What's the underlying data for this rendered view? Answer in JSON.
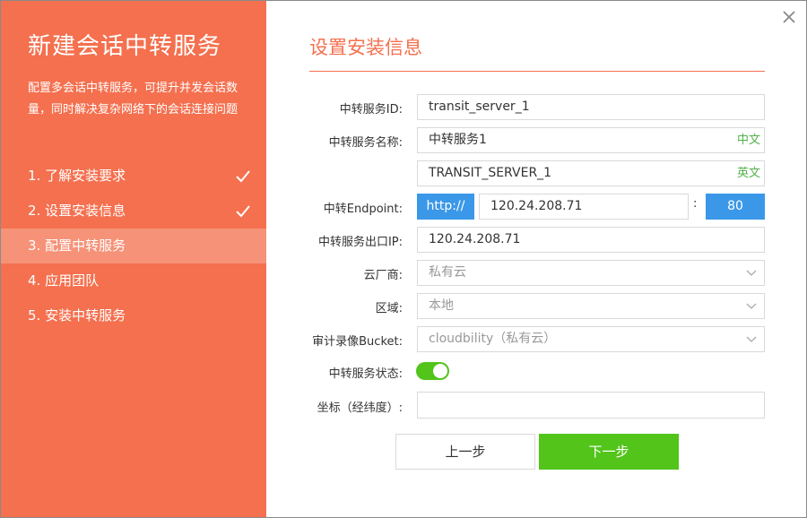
{
  "sidebar": {
    "title": "新建会话中转服务",
    "description": "配置多会话中转服务，可提升并发会话数量，同时解决复杂网络下的会话连接问题",
    "steps": [
      {
        "label": "1. 了解安装要求",
        "done": true
      },
      {
        "label": "2. 设置安装信息",
        "done": true
      },
      {
        "label": "3. 配置中转服务",
        "active": true
      },
      {
        "label": "4. 应用团队"
      },
      {
        "label": "5. 安装中转服务"
      }
    ]
  },
  "main": {
    "title": "设置安装信息",
    "fields": {
      "server_id": {
        "label": "中转服务ID:",
        "value": "transit_server_1"
      },
      "server_name": {
        "label": "中转服务名称:",
        "value_cn": "中转服务1",
        "suffix_cn": "中文",
        "value_en": "TRANSIT_SERVER_1",
        "suffix_en": "英文"
      },
      "endpoint": {
        "label": "中转Endpoint:",
        "protocol": "http://",
        "host": "120.24.208.71",
        "separator": ":",
        "port": "80"
      },
      "egress_ip": {
        "label": "中转服务出口IP:",
        "value": "120.24.208.71"
      },
      "cloud_vendor": {
        "label": "云厂商:",
        "value": "私有云"
      },
      "region": {
        "label": "区域:",
        "value": "本地"
      },
      "audit_bucket": {
        "label": "审计录像Bucket:",
        "value": "cloudbility（私有云）"
      },
      "status": {
        "label": "中转服务状态:",
        "enabled": true
      },
      "coordinates": {
        "label": "坐标（经纬度）:",
        "value": ""
      }
    },
    "buttons": {
      "prev": "上一步",
      "next": "下一步"
    }
  },
  "colors": {
    "accent": "#f4704f",
    "active_step": "#f69278",
    "blue": "#3b98e8",
    "green": "#52c41a"
  },
  "icons": {
    "close": "close-icon",
    "check": "check-icon",
    "dropdown": "chevron-down-icon"
  }
}
